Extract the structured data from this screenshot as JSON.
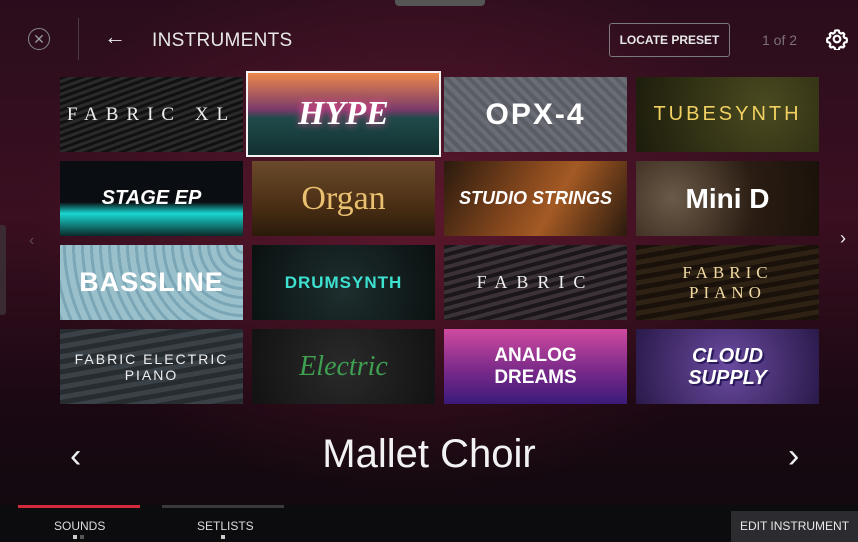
{
  "header": {
    "title": "INSTRUMENTS",
    "locate_label": "LOCATE PRESET",
    "pager": "1 of 2"
  },
  "instruments": [
    {
      "label": "FABRIC XL",
      "bg": "#1c1c1e"
    },
    {
      "label": "HYPE",
      "bg": "#1f4a4a"
    },
    {
      "label": "OPX-4",
      "bg": "#6a6d75"
    },
    {
      "label": "TUBESYNTH",
      "bg": "#2b2a14"
    },
    {
      "label": "STAGE EP",
      "bg": "#101418"
    },
    {
      "label": "Organ",
      "bg": "#4a2e14"
    },
    {
      "label": "STUDIO STRINGS",
      "bg": "#6a3d1a"
    },
    {
      "label": "Mini D",
      "bg": "#2a1c12"
    },
    {
      "label": "BASSLINE",
      "bg": "#8ab5c5"
    },
    {
      "label": "DRUMSYNTH",
      "bg": "#101a1a"
    },
    {
      "label": "FABRIC",
      "bg": "#2a2428"
    },
    {
      "label": "FABRIC PIANO",
      "bg": "#221a12"
    },
    {
      "label": "FABRIC ELECTRIC PIANO",
      "bg": "#2c3236"
    },
    {
      "label": "Electric",
      "bg": "#1c1c1c"
    },
    {
      "label": "ANALOG DREAMS",
      "bg": "#7a2a8a"
    },
    {
      "label": "CLOUD SUPPLY",
      "bg": "#3a2a5a"
    }
  ],
  "preset": {
    "name": "Mallet Choir"
  },
  "tabs": {
    "sounds": "SOUNDS",
    "setlists": "SETLISTS"
  },
  "edit_label": "EDIT INSTRUMENT",
  "colors": {
    "accent": "#d42a3c",
    "selected_outline": "#f3f3f3"
  }
}
